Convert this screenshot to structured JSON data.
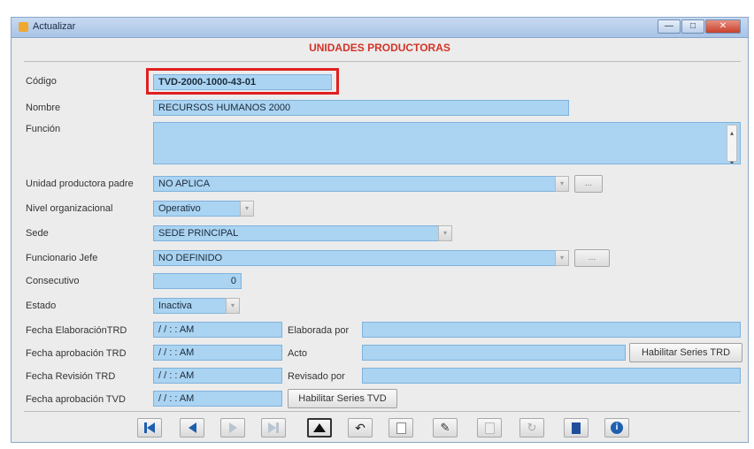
{
  "window": {
    "title": "Actualizar",
    "minimize": "—",
    "maximize": "□",
    "close": "✕"
  },
  "form": {
    "header": "UNIDADES PRODUCTORAS",
    "codigo": {
      "label": "Código",
      "value": "TVD-2000-1000-43-01"
    },
    "nombre": {
      "label": "Nombre",
      "value": "RECURSOS HUMANOS 2000"
    },
    "funcion": {
      "label": "Función",
      "value": ""
    },
    "unidad_padre": {
      "label": "Unidad productora padre",
      "value": "NO APLICA",
      "button": "..."
    },
    "nivel": {
      "label": "Nivel organizacional",
      "value": "Operativo"
    },
    "sede": {
      "label": "Sede",
      "value": "SEDE PRINCIPAL"
    },
    "funcionario": {
      "label": "Funcionario Jefe",
      "value": "NO DEFINIDO",
      "button": "..."
    },
    "consecutivo": {
      "label": "Consecutivo",
      "value": "0"
    },
    "estado": {
      "label": "Estado",
      "value": "Inactiva"
    },
    "fecha_elab_trd": {
      "label": "Fecha ElaboraciónTRD",
      "value": "/ /    :  : AM"
    },
    "fecha_aprob_trd": {
      "label": "Fecha aprobación TRD",
      "value": "/ /    :  : AM"
    },
    "fecha_rev_trd": {
      "label": "Fecha Revisión TRD",
      "value": "/ /    :  : AM"
    },
    "fecha_aprob_tvd": {
      "label": "Fecha aprobación TVD",
      "value": "/ /    :  : AM"
    },
    "elaborada_por": {
      "label": "Elaborada por",
      "value": ""
    },
    "acto": {
      "label": "Acto",
      "value": ""
    },
    "revisado_por": {
      "label": "Revisado por",
      "value": ""
    },
    "btn_series_trd": "Habilitar Series TRD",
    "btn_series_tvd": "Habilitar Series TVD"
  },
  "colors": {
    "field_bg": "#aad4f2",
    "header": "#d2342a",
    "highlight": "#e02020"
  }
}
